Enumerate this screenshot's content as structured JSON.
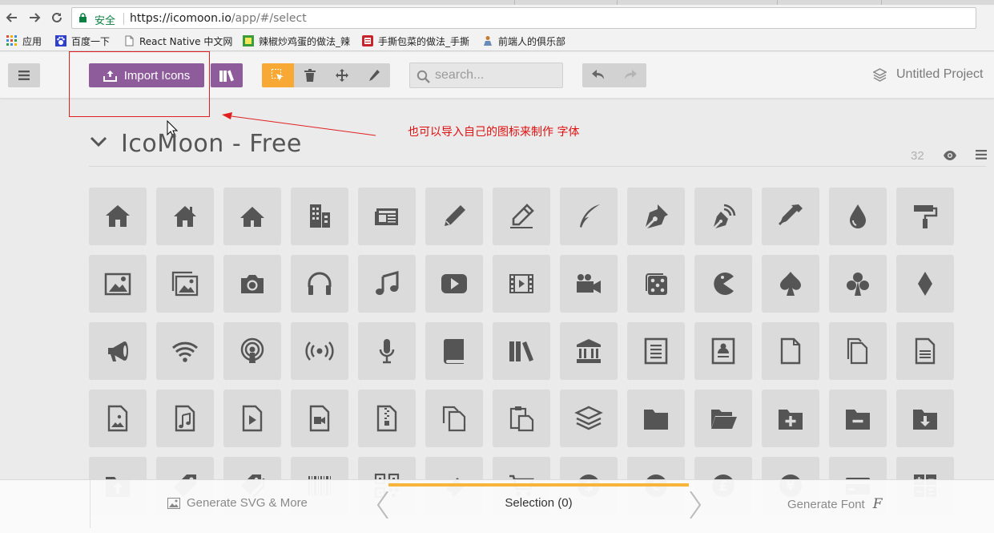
{
  "browser": {
    "secure_label": "安全",
    "url_host": "https://icomoon.io",
    "url_path": "/app/#/select",
    "bookmarks": [
      {
        "label": "应用",
        "icon": "apps-grid-icon"
      },
      {
        "label": "百度一下",
        "icon": "baidu-paw-icon"
      },
      {
        "label": "React Native 中文网",
        "icon": "page-icon"
      },
      {
        "label": "辣椒炒鸡蛋的做法_辣",
        "icon": "recipe-site-icon"
      },
      {
        "label": "手撕包菜的做法_手撕",
        "icon": "recipe-book-icon"
      },
      {
        "label": "前端人的俱乐部",
        "icon": "person-icon"
      }
    ]
  },
  "header": {
    "import_label": "Import Icons",
    "search_placeholder": "search...",
    "project_name": "Untitled Project"
  },
  "annotation": {
    "note": "也可以导入自己的图标来制作 字体"
  },
  "set": {
    "title": "IcoMoon - Free",
    "count": "32"
  },
  "icons": [
    "home",
    "home2",
    "home3",
    "office",
    "newspaper",
    "pencil",
    "pencil2",
    "quill",
    "pen",
    "blog",
    "eyedropper",
    "droplet",
    "paint-format",
    "image",
    "images",
    "camera",
    "headphones",
    "music",
    "play",
    "film",
    "video-camera",
    "dice",
    "pacman",
    "spades",
    "clubs",
    "diamonds",
    "bullhorn",
    "connection",
    "podcast",
    "feed",
    "mic",
    "book",
    "books",
    "library",
    "file-text",
    "profile",
    "file-empty",
    "files-empty",
    "file-text2",
    "file-picture",
    "file-music",
    "file-play",
    "file-video",
    "file-zip",
    "copy",
    "paste",
    "stack",
    "folder",
    "folder-open",
    "folder-plus",
    "folder-minus",
    "folder-download",
    "folder-upload",
    "price-tag",
    "price-tags",
    "barcode",
    "qrcode",
    "ticket",
    "cart",
    "coin-dollar",
    "coin-euro",
    "coin-pound",
    "coin-yen",
    "credit-card",
    "calculator"
  ],
  "bottom": {
    "generate_svg": "Generate SVG & More",
    "selection": "Selection (0)",
    "generate_font": "Generate Font",
    "font_glyph": "F"
  }
}
